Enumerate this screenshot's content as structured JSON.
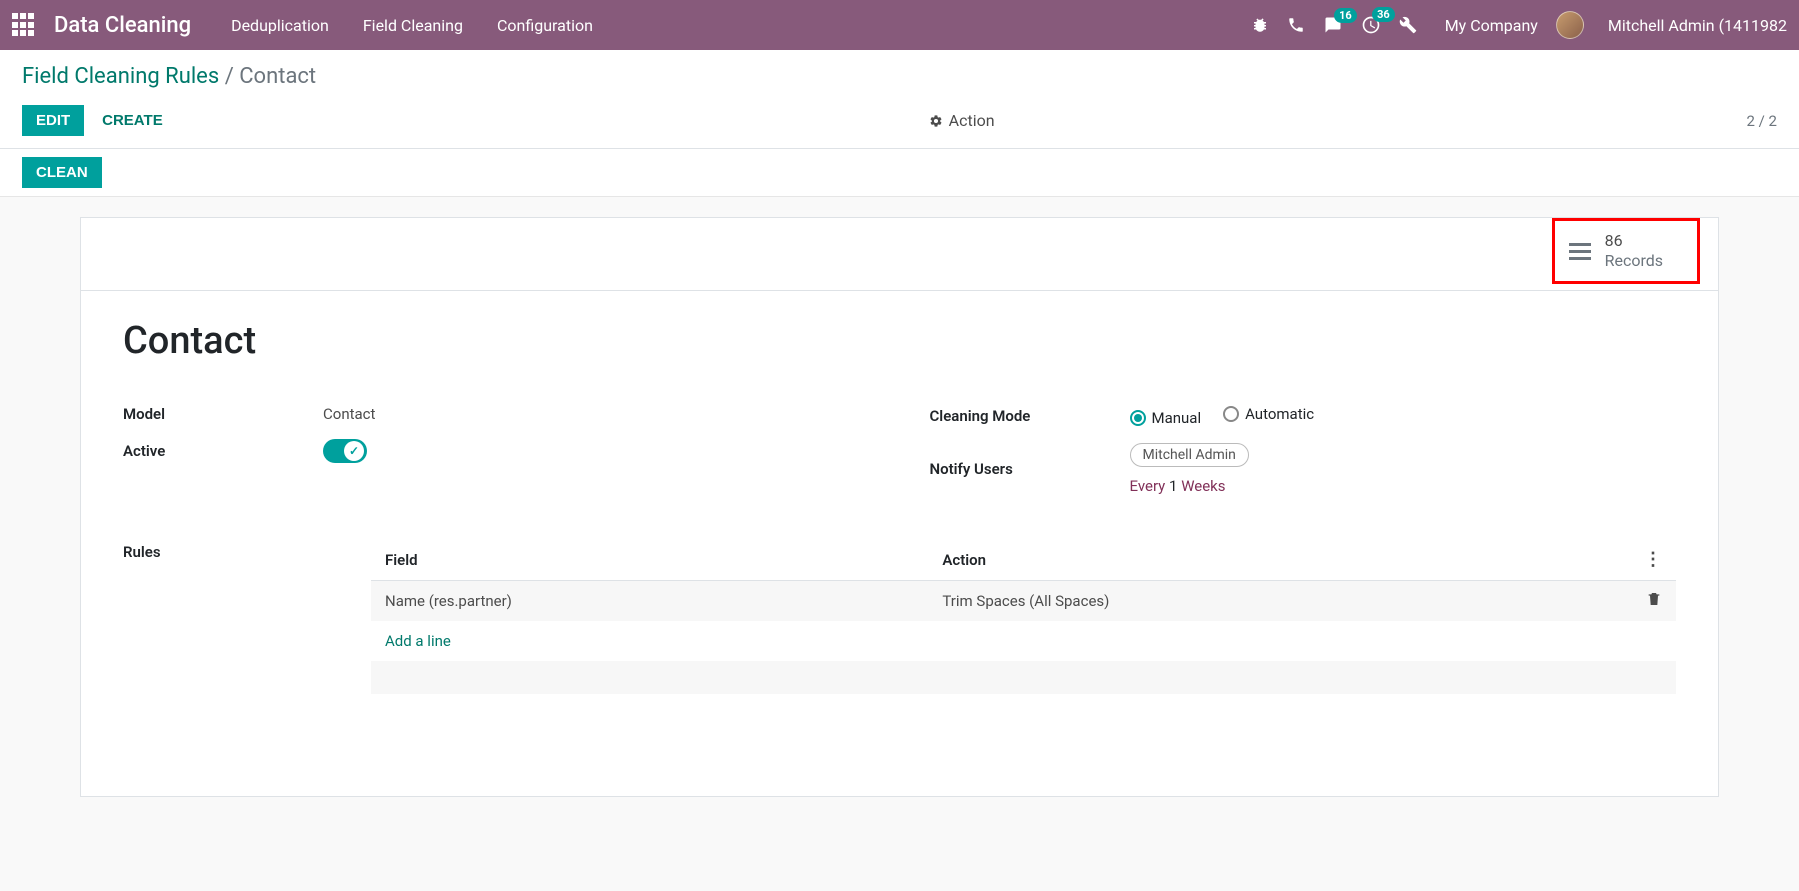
{
  "navbar": {
    "brand": "Data Cleaning",
    "menu": {
      "dedup": "Deduplication",
      "field": "Field Cleaning",
      "config": "Configuration"
    },
    "badges": {
      "messages": "16",
      "activities": "36"
    },
    "company": "My Company",
    "user": "Mitchell Admin (1411982"
  },
  "breadcrumb": {
    "parent": "Field Cleaning Rules",
    "current": "Contact"
  },
  "controls": {
    "edit": "EDIT",
    "create": "CREATE",
    "action": "Action",
    "pager": "2 / 2",
    "clean": "CLEAN"
  },
  "statbox": {
    "count": "86",
    "label": "Records"
  },
  "form": {
    "title": "Contact",
    "labels": {
      "model": "Model",
      "active": "Active",
      "cleaning_mode": "Cleaning Mode",
      "notify_users": "Notify Users",
      "rules": "Rules"
    },
    "model_value": "Contact",
    "cleaning_mode": {
      "manual": "Manual",
      "automatic": "Automatic"
    },
    "notify_user_tag": "Mitchell Admin",
    "notify_every": "Every",
    "notify_interval": "1",
    "notify_unit": "Weeks"
  },
  "rules_table": {
    "headers": {
      "field": "Field",
      "action": "Action"
    },
    "row": {
      "field": "Name (res.partner)",
      "action": "Trim Spaces (All Spaces)"
    },
    "add_line": "Add a line"
  }
}
